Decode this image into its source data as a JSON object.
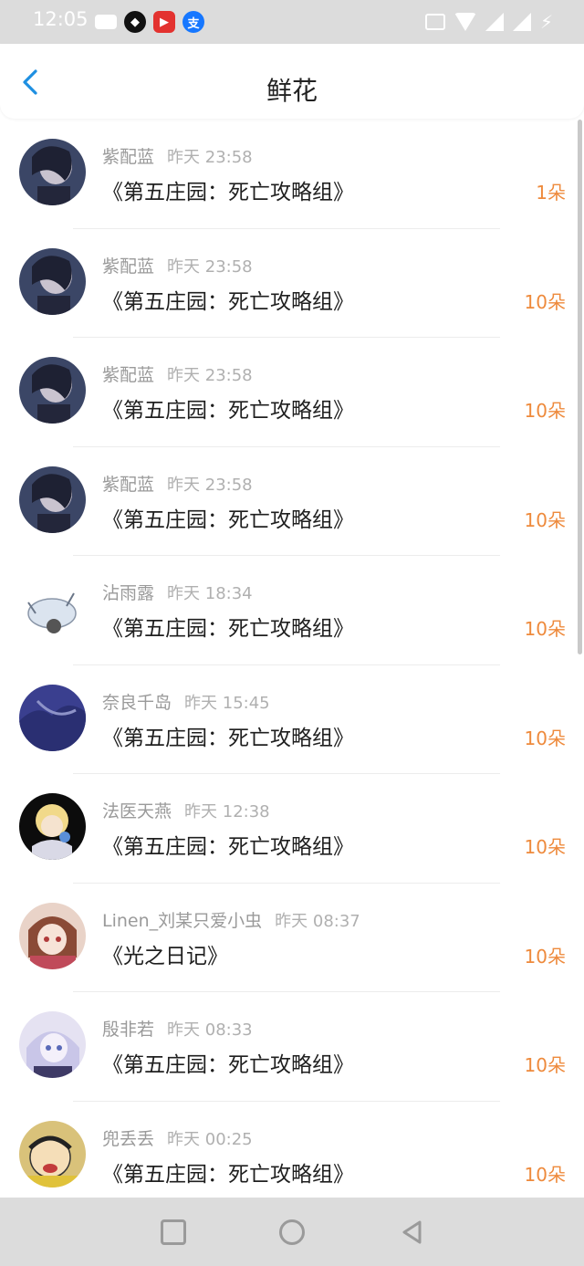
{
  "status_bar": {
    "time": "12:05"
  },
  "header": {
    "title": "鲜花"
  },
  "items": [
    {
      "user": "紫配蓝",
      "time": "昨天 23:58",
      "book": "《第五庄园：死亡攻略组》",
      "count": "1朵",
      "avatar": "anime-character-avatar"
    },
    {
      "user": "紫配蓝",
      "time": "昨天 23:58",
      "book": "《第五庄园：死亡攻略组》",
      "count": "10朵",
      "avatar": "anime-character-avatar"
    },
    {
      "user": "紫配蓝",
      "time": "昨天 23:58",
      "book": "《第五庄园：死亡攻略组》",
      "count": "10朵",
      "avatar": "anime-character-avatar"
    },
    {
      "user": "紫配蓝",
      "time": "昨天 23:58",
      "book": "《第五庄园：死亡攻略组》",
      "count": "10朵",
      "avatar": "anime-character-avatar"
    },
    {
      "user": "沾雨露",
      "time": "昨天 18:34",
      "book": "《第五庄园：死亡攻略组》",
      "count": "10朵",
      "avatar": "cartoon-creature-avatar"
    },
    {
      "user": "奈良千岛",
      "time": "昨天 15:45",
      "book": "《第五庄园：死亡攻略组》",
      "count": "10朵",
      "avatar": "blue-artwork-avatar"
    },
    {
      "user": "法医天燕",
      "time": "昨天 12:38",
      "book": "《第五庄园：死亡攻略组》",
      "count": "10朵",
      "avatar": "anime-character-avatar"
    },
    {
      "user": "Linen_刘某只爱小虫",
      "time": "昨天 08:37",
      "book": "《光之日记》",
      "count": "10朵",
      "avatar": "anime-girl-avatar"
    },
    {
      "user": "殷非若",
      "time": "昨天 08:33",
      "book": "《第五庄园：死亡攻略组》",
      "count": "10朵",
      "avatar": "anime-girl-avatar"
    },
    {
      "user": "兜丢丢",
      "time": "昨天 00:25",
      "book": "《第五庄园：死亡攻略组》",
      "count": "10朵",
      "avatar": "cartoon-boy-avatar"
    }
  ],
  "colors": {
    "accent_orange": "#ee8a3c",
    "back_blue": "#1e8fe1"
  }
}
